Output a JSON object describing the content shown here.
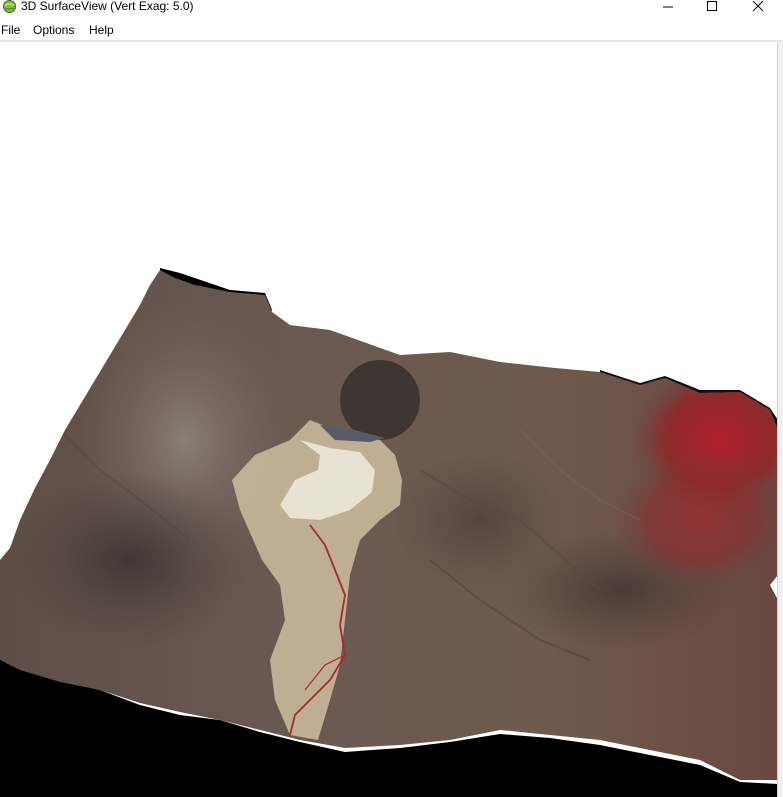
{
  "window": {
    "title": "3D SurfaceView (Vert Exag: 5.0)",
    "icon": "globe-icon",
    "controls": {
      "minimize": "minimize-icon",
      "maximize": "maximize-icon",
      "close": "close-icon"
    }
  },
  "menu": {
    "items": [
      {
        "label": "File"
      },
      {
        "label": "Options"
      },
      {
        "label": "Help"
      }
    ]
  },
  "view": {
    "content": "3D terrain surface rendered with false-color satellite imagery",
    "background": "#ffffff",
    "colors": {
      "terrain_brown": "#6b5a50",
      "playa_light": "#d8ccb4",
      "vegetation_red": "#9a1f2a",
      "underside_black": "#000000"
    }
  }
}
